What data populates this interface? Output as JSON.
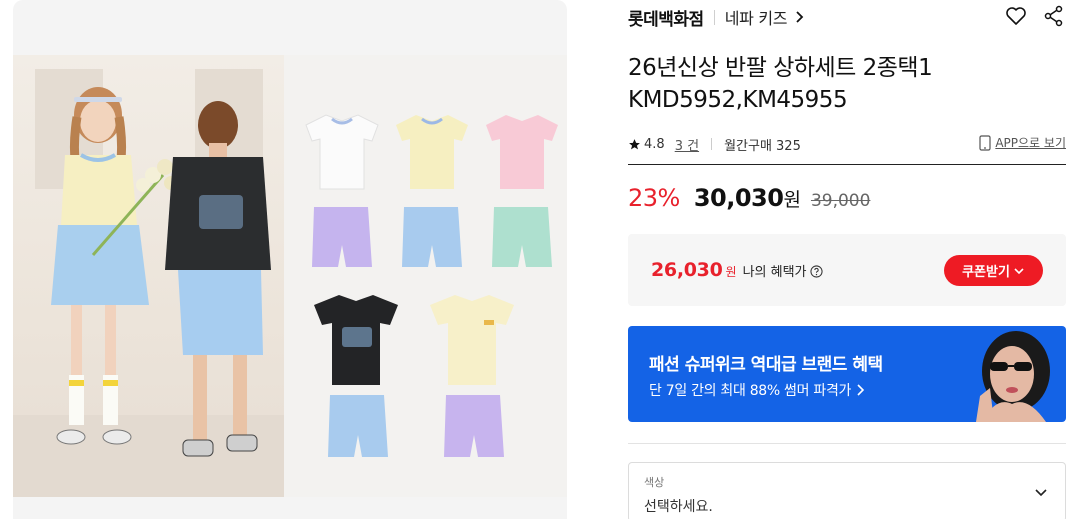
{
  "brand": {
    "name": "롯데백화점",
    "sub_brand": "네파 키즈"
  },
  "product": {
    "title_line1": "26년신상 반팔 상하세트 2종택1",
    "title_line2": "KMD5952,KM45955"
  },
  "meta": {
    "rating": "4.8",
    "reviews": "3 건",
    "monthly": "월간구매 325",
    "app_link": "APP으로 보기"
  },
  "price": {
    "discount": "23%",
    "sale": "30,030",
    "won": "원",
    "original": "39,000"
  },
  "benefit": {
    "price": "26,030",
    "won": "원",
    "label": "나의 혜택가",
    "coupon_button": "쿠폰받기"
  },
  "banner": {
    "title": "패션 슈퍼위크 역대급 브랜드 혜택",
    "subtitle": "단 7일 간의 최대 88% 썸머 파격가"
  },
  "option": {
    "label": "색상",
    "placeholder": "선택하세요."
  },
  "colors": {
    "accent_red": "#e8212c",
    "banner_blue": "#1463e6"
  },
  "icons": [
    "heart-icon",
    "share-icon",
    "star-icon",
    "phone-icon",
    "help-icon",
    "chevron-down-icon",
    "chevron-right-icon"
  ]
}
